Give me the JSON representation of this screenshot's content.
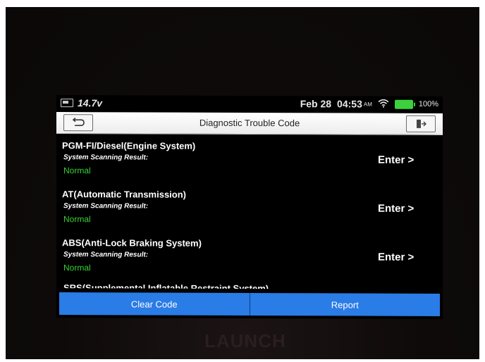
{
  "status": {
    "voltage": "14.7v",
    "date": "Feb 28",
    "time": "04:53",
    "ampm": "AM",
    "battery_pct": "100%",
    "battery_color": "#3cd13c"
  },
  "header": {
    "title": "Diagnostic Trouble Code",
    "back_icon": "back-arrow-icon",
    "exit_icon": "exit-icon"
  },
  "systems": [
    {
      "name": "PGM-FI/Diesel(Engine System)",
      "scan_label": "System Scanning Result:",
      "result": "Normal",
      "action": "Enter >"
    },
    {
      "name": "AT(Automatic Transmission)",
      "scan_label": "System Scanning Result:",
      "result": "Normal",
      "action": "Enter >"
    },
    {
      "name": "ABS(Anti-Lock Braking System)",
      "scan_label": "System Scanning Result:",
      "result": "Normal",
      "action": "Enter >"
    }
  ],
  "partial_system": "SRS(Supplemental Inflatable Restraint System)",
  "footer": {
    "clear_code": "Clear Code",
    "report": "Report",
    "accent": "#2a7ce6"
  },
  "device": {
    "brand": "LAUNCH"
  },
  "colors": {
    "normal_status": "#34d234"
  }
}
